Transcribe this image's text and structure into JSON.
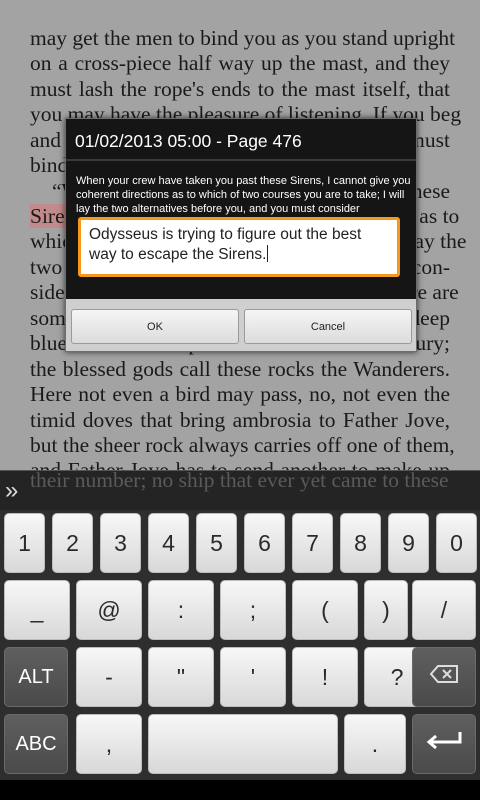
{
  "reader": {
    "lines": [
      "may get the men to bind you as you stand upright",
      "on a cross-piece half way up the mast, and they",
      "must lash the rope's ends to the mast itself, that",
      "you may have the pleasure of listening. If you beg",
      "and pray the men to unloose you, then they must",
      "bind you faster.",
      "“When your crew have taken you past these",
      "Sirens, I cannot give you coherent directions as to",
      "which of two courses you are to take; I will lay the",
      "two alternatives before you, and you must con-",
      "sider them for yourself. On the one hand there are",
      "some overhanging rocks against which the deep",
      "blue waves of Amphitrite beat with terrific fury;",
      "the blessed gods call these rocks the Wanderers.",
      "Here not even a bird may pass, no, not even the",
      "timid doves that bring ambrosia to Father Jove,",
      "but the sheer rock always carries off one of them,",
      "and Father Jove has to send another to make up",
      "their number; no ship that ever yet came to these"
    ],
    "highlight_word": "Sirens"
  },
  "dialog": {
    "title": "01/02/2013 05:00 - Page 476",
    "excerpt": "When your crew have taken you past these Sirens, I cannot give you coherent directions as to which of two courses you are to take; I will lay the two alternatives before you, and you must consider",
    "note": "Odysseus is trying to figure out the best way to escape the Sirens.",
    "ok_label": "OK",
    "cancel_label": "Cancel",
    "accent": "#f39a1e"
  },
  "suggestion_strip": {
    "expand_icon": "double-chevron-right-icon",
    "expand_glyph": "»"
  },
  "keyboard": {
    "row1": [
      "1",
      "2",
      "3",
      "4",
      "5",
      "6",
      "7",
      "8",
      "9",
      "0"
    ],
    "row2": [
      "_",
      "@",
      ":",
      ";",
      "(",
      ")",
      "/"
    ],
    "row3": {
      "alt": "ALT",
      "keys": [
        "-",
        "\"",
        "'",
        "!",
        "?"
      ],
      "delete_icon": "backspace-icon"
    },
    "row4": {
      "abc": "ABC",
      "comma": ",",
      "period": ".",
      "enter_icon": "enter-icon"
    }
  }
}
